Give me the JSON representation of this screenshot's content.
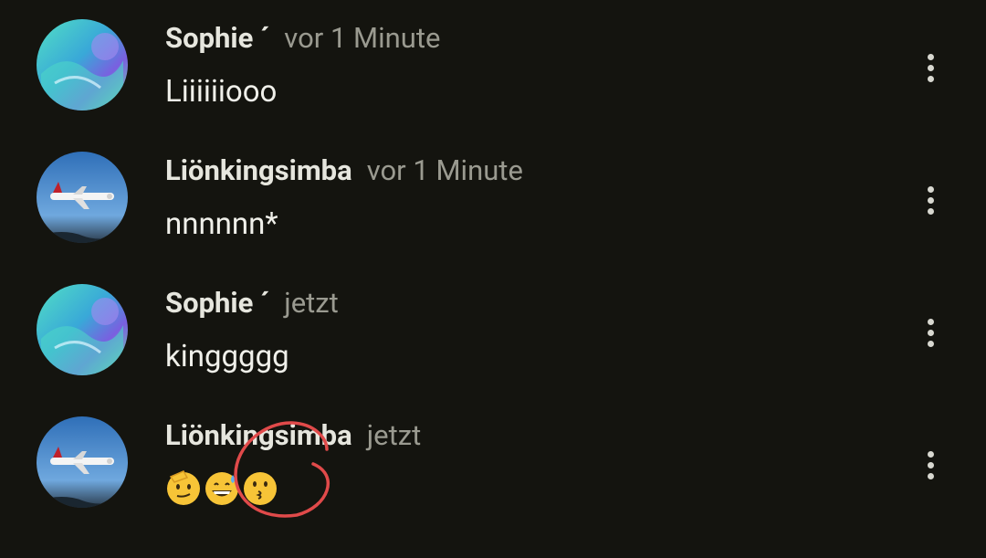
{
  "comments": [
    {
      "name": "Sophie ´",
      "time": "vor 1 Minute",
      "text": "Liiiiiiooo",
      "avatar": "abstract-teal-purple-art"
    },
    {
      "name": "Liönkingsimba",
      "time": "vor 1 Minute",
      "text": "nnnnnn*",
      "avatar": "airplane-sky"
    },
    {
      "name": "Sophie ´",
      "time": "jetzt",
      "text": "kinggggg",
      "avatar": "abstract-teal-purple-art"
    },
    {
      "name": "Liönkingsimba",
      "time": "jetzt",
      "text": "",
      "avatar": "airplane-sky",
      "emojis": [
        "saluting-face-icon",
        "grinning-sweat-face-icon",
        "kissing-face-icon"
      ]
    }
  ],
  "colors": {
    "background": "#14140f",
    "name": "#e6e6de",
    "time": "#9a9a90",
    "annotation": "#e04a4a"
  },
  "icons": {
    "more": "more-vertical-icon"
  }
}
